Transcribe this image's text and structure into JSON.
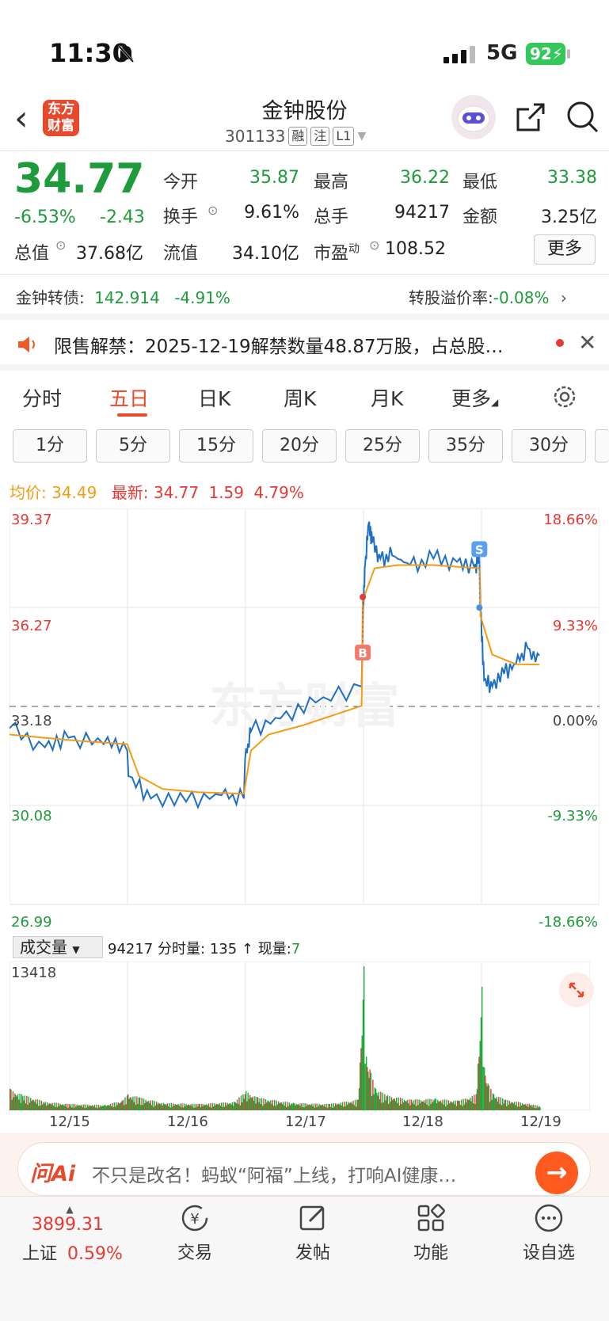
{
  "status": {
    "time": "11:30",
    "network": "5G",
    "battery": "92"
  },
  "header": {
    "logo": "东方\n财富",
    "logo_line1": "东方",
    "logo_line2": "财富",
    "title": "金钟股份",
    "code": "301133",
    "tags": [
      "融",
      "注",
      "L1"
    ]
  },
  "quote": {
    "price": "34.77",
    "change_pct": "-6.53%",
    "change": "-2.43",
    "open_label": "今开",
    "open": "35.87",
    "high_label": "最高",
    "high": "36.22",
    "low_label": "最低",
    "low": "33.38",
    "turnover_label": "换手",
    "turnover": "9.61%",
    "volume_label": "总手",
    "volume": "94217",
    "amount_label": "金额",
    "amount": "3.25亿",
    "total_cap_label": "总值",
    "total_cap": "37.68亿",
    "float_cap_label": "流值",
    "float_cap": "34.10亿",
    "pe_label": "市盈",
    "pe_sup": "动",
    "pe": "108.52",
    "more": "更多"
  },
  "bond": {
    "label": "金钟转债:",
    "price": "142.914",
    "change": "-4.91%",
    "premium_label": "转股溢价率:",
    "premium": "-0.08%"
  },
  "notice": {
    "text": "限售解禁：2025-12-19解禁数量48.87万股，占总股…"
  },
  "tabs": [
    "分时",
    "五日",
    "日K",
    "周K",
    "月K",
    "更多"
  ],
  "active_tab": "五日",
  "intervals": [
    "1分",
    "5分",
    "15分",
    "20分",
    "25分",
    "35分",
    "30分"
  ],
  "chart_legend": {
    "avg_label": "均价:",
    "avg": "34.49",
    "latest_label": "最新:",
    "latest": "34.77",
    "latest_change": "1.59",
    "latest_pct": "4.79%"
  },
  "chart_data": {
    "type": "line",
    "y_left_ticks": [
      "39.37",
      "36.27",
      "33.18",
      "30.08",
      "26.99"
    ],
    "y_right_ticks": [
      "18.66%",
      "9.33%",
      "0.00%",
      "-9.33%",
      "-18.66%"
    ],
    "x_ticks": [
      "12/15",
      "12/16",
      "12/17",
      "12/18",
      "12/19"
    ],
    "ylim": [
      26.99,
      39.37
    ],
    "reference_price": 33.18,
    "series": [
      {
        "color": "#1f6fc5",
        "x": [
          0,
          0.3,
          0.5,
          0.8,
          1.0,
          1.01,
          1.2,
          1.5,
          1.8,
          1.99,
          2.0,
          2.05,
          2.3,
          2.6,
          2.99,
          3.0,
          3.02,
          3.05,
          3.08,
          3.15,
          3.25,
          3.4,
          3.6,
          3.8,
          3.95,
          3.99,
          4.0,
          4.03,
          4.1,
          4.2,
          4.3,
          4.4,
          4.5
        ],
        "y": [
          32.5,
          31.9,
          32.2,
          32.0,
          31.8,
          31.0,
          30.3,
          30.2,
          30.4,
          30.3,
          31.5,
          32.4,
          32.8,
          33.3,
          33.8,
          35.8,
          37.6,
          38.9,
          38.3,
          37.8,
          37.9,
          37.6,
          37.8,
          37.7,
          37.5,
          37.8,
          36.2,
          34.0,
          33.8,
          34.2,
          34.5,
          35.0,
          34.77
        ]
      },
      {
        "color": "#f39c12",
        "x": [
          0,
          0.3,
          0.6,
          1.0,
          1.1,
          1.3,
          1.6,
          1.99,
          2.05,
          2.2,
          2.5,
          2.99,
          3.0,
          3.1,
          3.3,
          3.6,
          3.99,
          4.0,
          4.1,
          4.3,
          4.5
        ],
        "y": [
          32.3,
          32.2,
          32.1,
          32.0,
          31.0,
          30.6,
          30.5,
          30.45,
          31.8,
          32.3,
          32.6,
          33.2,
          36.5,
          37.5,
          37.6,
          37.6,
          37.5,
          36.0,
          34.8,
          34.5,
          34.49
        ]
      }
    ],
    "markers": [
      {
        "label": "B",
        "x": 3.0,
        "y": 36.6
      },
      {
        "label": "S",
        "x": 3.99,
        "y": 37.8
      }
    ]
  },
  "volume": {
    "selector": "成交量",
    "total": "94217",
    "min_label": "分时量:",
    "min_vol": "135",
    "arrow": "↑",
    "now_label": "现量:",
    "now": "7",
    "max": "13418",
    "bars": [
      [
        0,
        2
      ],
      [
        0.1,
        1.5
      ],
      [
        0.3,
        0.8
      ],
      [
        0.5,
        0.6
      ],
      [
        0.8,
        0.5
      ],
      [
        0.95,
        0.9
      ],
      [
        1.0,
        1.5
      ],
      [
        1.1,
        1.2
      ],
      [
        1.3,
        0.7
      ],
      [
        1.6,
        0.6
      ],
      [
        1.9,
        0.8
      ],
      [
        2.0,
        1.8
      ],
      [
        2.1,
        1.2
      ],
      [
        2.4,
        0.7
      ],
      [
        2.7,
        0.6
      ],
      [
        2.95,
        1.0
      ],
      [
        3.0,
        13.4
      ],
      [
        3.02,
        5.0
      ],
      [
        3.05,
        3.8
      ],
      [
        3.1,
        2.0
      ],
      [
        3.2,
        1.4
      ],
      [
        3.4,
        1.0
      ],
      [
        3.6,
        1.1
      ],
      [
        3.8,
        0.9
      ],
      [
        3.95,
        1.5
      ],
      [
        4.0,
        11.5
      ],
      [
        4.02,
        4.0
      ],
      [
        4.05,
        2.5
      ],
      [
        4.1,
        1.5
      ],
      [
        4.2,
        1.0
      ],
      [
        4.4,
        0.6
      ],
      [
        4.5,
        0.4
      ]
    ]
  },
  "ai_bar": {
    "brand": "问Ai",
    "text": "不只是改名！蚂蚁“阿福”上线，打响AI健康…"
  },
  "index": {
    "value": "3899.31",
    "name": "上证",
    "pct": "0.59%"
  },
  "nav": [
    "交易",
    "发帖",
    "功能",
    "设自选"
  ],
  "colors": {
    "up": "#e53935",
    "down": "#1e9b3a",
    "accent": "#e8482c",
    "price_line": "#1f6fc5",
    "avg_line": "#f39c12"
  }
}
